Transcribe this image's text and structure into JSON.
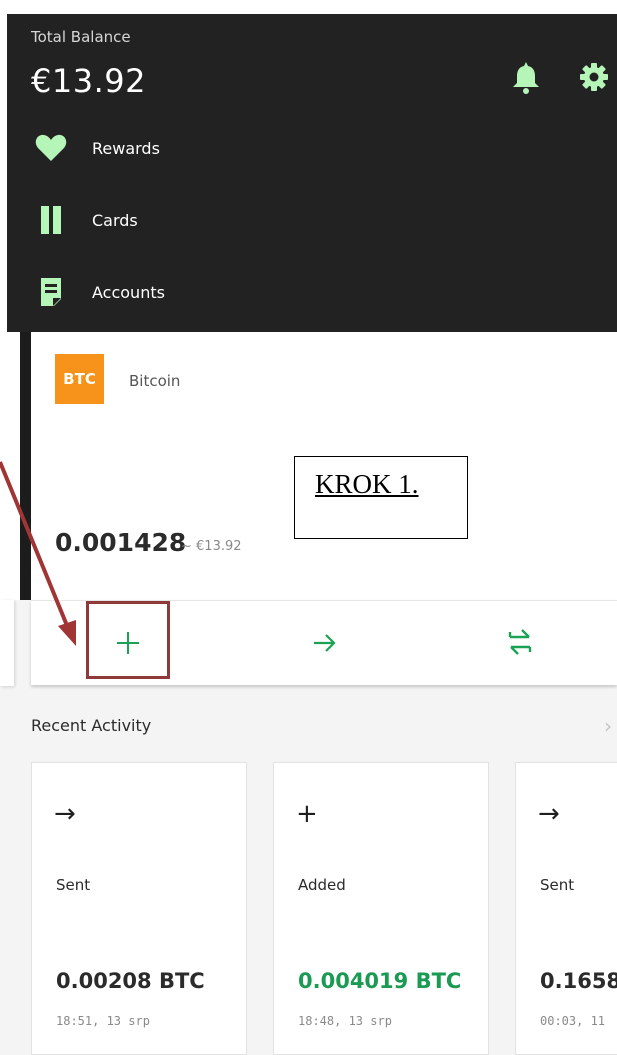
{
  "header": {
    "total_label": "Total Balance",
    "total_value": "€13.92",
    "icons": [
      "bell-icon",
      "gear-icon"
    ],
    "accent_color": "#b6f5b8",
    "nav": [
      {
        "label": "Rewards",
        "icon": "heart-icon"
      },
      {
        "label": "Cards",
        "icon": "cards-icon"
      },
      {
        "label": "Accounts",
        "icon": "accounts-icon"
      }
    ]
  },
  "wallet": {
    "badge": "BTC",
    "badge_color": "#f7931a",
    "name": "Bitcoin",
    "amount": "0.001428",
    "fiat": "~ €13.92",
    "actions": [
      "plus-icon",
      "arrow-right-icon",
      "swap-icon"
    ],
    "action_color": "#1aa354"
  },
  "annotation": {
    "text": "KROK 1.",
    "color": "#a03535"
  },
  "recent": {
    "title": "Recent Activity",
    "items": [
      {
        "icon": "→",
        "type": "Sent",
        "amount": "0.00208 BTC",
        "time": "18:51, 13 srp",
        "amount_color": "#2b2b2b"
      },
      {
        "icon": "+",
        "type": "Added",
        "amount": "0.004019 BTC",
        "time": "18:48, 13 srp",
        "amount_color": "#1a9a52"
      },
      {
        "icon": "→",
        "type": "Sent",
        "amount": "0.1658",
        "time": "00:03, 11",
        "amount_color": "#2b2b2b"
      }
    ]
  }
}
